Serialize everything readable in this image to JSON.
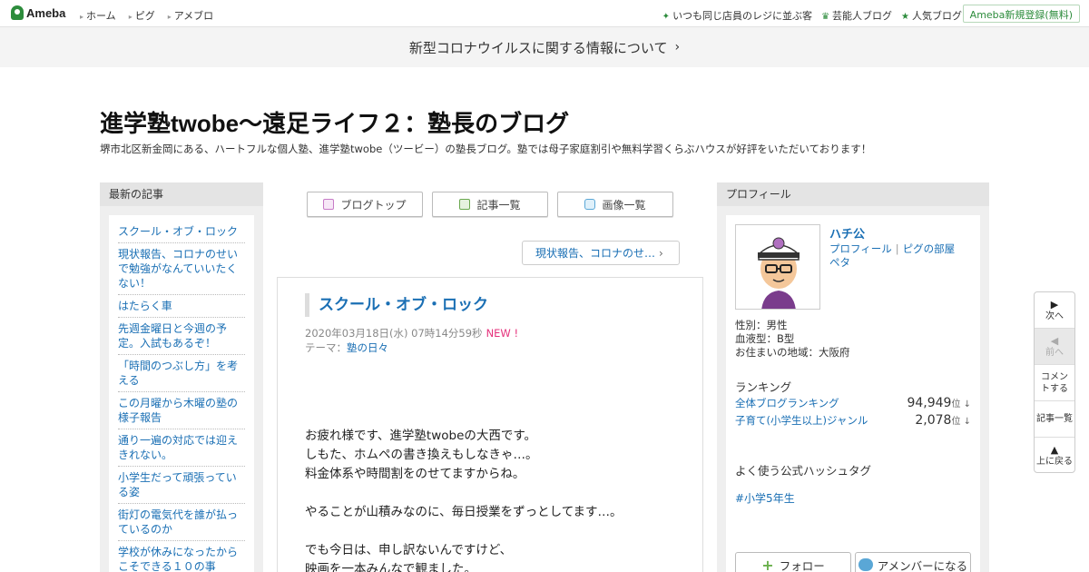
{
  "topbar": {
    "logo": "Ameba",
    "nav": [
      "ホーム",
      "ピグ",
      "アメブロ"
    ],
    "right": [
      "いつも同じ店員のレジに並ぶ客",
      "芸能人ブログ",
      "人気ブログ"
    ],
    "register": "Ameba新規登録(無料)"
  },
  "banner": {
    "text": "新型コロナウイルスに関する情報について"
  },
  "blog": {
    "title": "進学塾twobe～遠足ライフ２：塾長のブログ",
    "description": "堺市北区新金岡にある、ハートフルな個人塾、進学塾twobe（ツービー）の塾長ブログ。塾では母子家庭割引や無料学習くらぶハウスが好評をいただいております！"
  },
  "left": {
    "heading": "最新の記事",
    "items": [
      "スクール・オブ・ロック",
      "現状報告、コロナのせいで勉強がなんていいたくない！",
      "はたらく車",
      "先週金曜日と今週の予定。入試もあるぞ！",
      "「時間のつぶし方」を考える",
      "この月曜から木曜の塾の様子報告",
      "通り一遍の対応では迎えきれない。",
      "小学生だって頑張っている姿",
      "街灯の電気代を誰が払っているのか",
      "学校が休みになったからこそできる１０の事"
    ]
  },
  "nav": {
    "top": "ブログトップ",
    "list": "記事一覧",
    "images": "画像一覧"
  },
  "prev_post": "現状報告、コロナのせ…",
  "article": {
    "title": "スクール・オブ・ロック",
    "date": "2020年03月18日(水) 07時14分59秒",
    "new_badge": "NEW !",
    "theme_label": "テーマ：",
    "theme": "塾の日々",
    "body": [
      "お疲れ様です、進学塾twobeの大西です。",
      "しもた、ホムペの書き換えもしなきゃ…。",
      "料金体系や時間割をのせてますからね。",
      "",
      "やることが山積みなのに、毎日授業をずっとしてます…。",
      "",
      "でも今日は、申し訳ないんですけど、",
      "映画を一本みんなで観ました。"
    ]
  },
  "profile": {
    "heading": "プロフィール",
    "name": "ハチ公",
    "link_profile": "プロフィール",
    "link_pig": "ピグの部屋",
    "link_peta": "ペタ",
    "gender": "性別：男性",
    "blood": "血液型：B型",
    "area": "お住まいの地域：大阪府",
    "ranking_heading": "ランキング",
    "rankings": [
      {
        "label": "全体ブログランキング",
        "value": "94,949",
        "unit": "位 ↓"
      },
      {
        "label": "子育て(小学生以上)ジャンル",
        "value": "2,078",
        "unit": "位 ↓"
      }
    ],
    "hashtag_heading": "よく使う公式ハッシュタグ",
    "hashtag": "#小学5年生",
    "follow": "フォロー",
    "amember": "アメンバーになる"
  },
  "floatnav": {
    "next": "次へ",
    "prev": "前へ",
    "comment": "コメントする",
    "list": "記事一覧",
    "top": "上に戻る"
  },
  "colors": {
    "link": "#1a6fb4",
    "ameba_green": "#2d8c3c",
    "new_badge": "#e5317b"
  }
}
